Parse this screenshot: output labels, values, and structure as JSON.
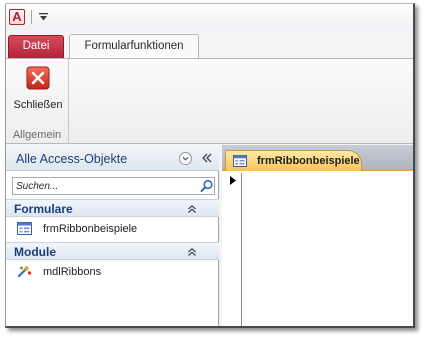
{
  "quick_access": {
    "app_icon_letter": "A"
  },
  "tabs": {
    "file": "Datei",
    "active": "Formularfunktionen"
  },
  "ribbon": {
    "close_label": "Schließen",
    "group_label": "Allgemein"
  },
  "nav_pane": {
    "title": "Alle Access-Objekte",
    "search_placeholder": "Suchen...",
    "groups": [
      {
        "label": "Formulare",
        "items": [
          "frmRibbonbeispiele"
        ]
      },
      {
        "label": "Module",
        "items": [
          "mdlRibbons"
        ]
      }
    ]
  },
  "document": {
    "tab_label": "frmRibbonbeispiele"
  },
  "colors": {
    "file_tab": "#c22f45",
    "close_red": "#d9392e",
    "doc_tab": "#f8cd6a",
    "nav_text": "#1b3f79"
  }
}
